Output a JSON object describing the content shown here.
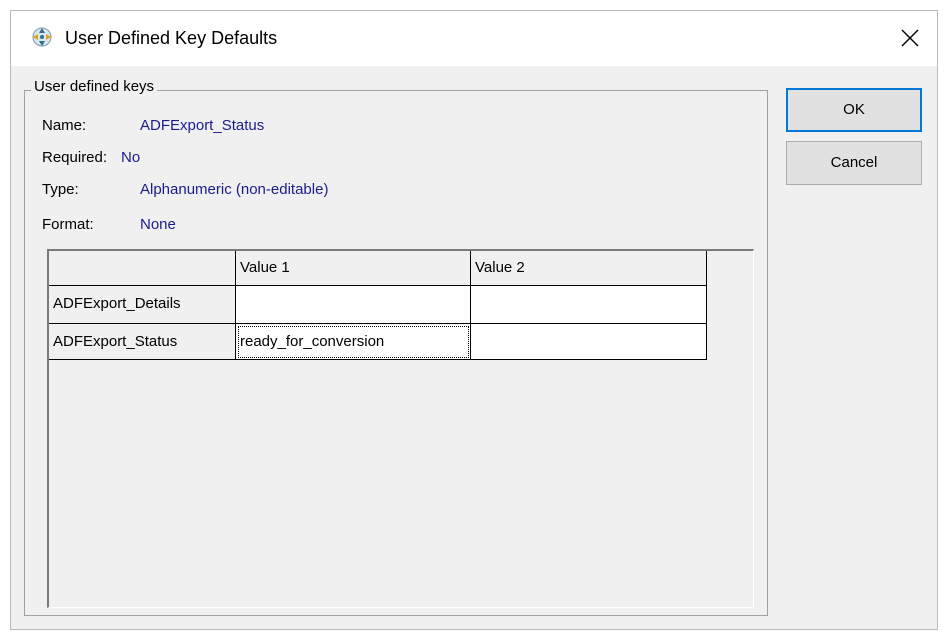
{
  "window": {
    "title": "User Defined Key Defaults",
    "icon": "app-crosshair-icon",
    "close_label": "×"
  },
  "group": {
    "legend": "User defined keys",
    "name_label": "Name:",
    "name_value": "ADFExport_Status",
    "required_label": "Required:",
    "required_value": "No",
    "type_label": "Type:",
    "type_value": "Alphanumeric (non-editable)",
    "format_label": "Format:",
    "format_value": "None"
  },
  "buttons": {
    "ok": "OK",
    "cancel": "Cancel"
  },
  "table": {
    "columns": [
      "",
      "Value 1",
      "Value 2"
    ],
    "rows": [
      {
        "key": "ADFExport_Details",
        "value1": "",
        "value2": ""
      },
      {
        "key": "ADFExport_Status",
        "value1": "ready_for_conversion",
        "value2": ""
      }
    ]
  },
  "colors": {
    "value_text": "#1b1b8f",
    "ok_focus_border": "#0078d7",
    "dialog_bg": "#f0f0f0"
  }
}
